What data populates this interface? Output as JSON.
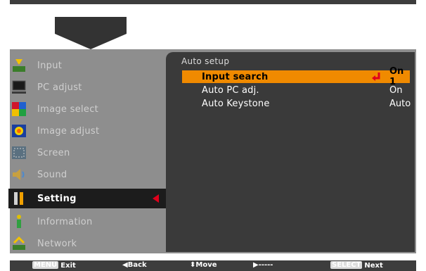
{
  "menu": {
    "items": [
      {
        "label": "Input",
        "icon": "input-icon"
      },
      {
        "label": "PC adjust",
        "icon": "pc-adjust-icon"
      },
      {
        "label": "Image select",
        "icon": "image-select-icon"
      },
      {
        "label": "Image adjust",
        "icon": "image-adjust-icon"
      },
      {
        "label": "Screen",
        "icon": "screen-icon"
      },
      {
        "label": "Sound",
        "icon": "sound-icon"
      },
      {
        "label": "Setting",
        "icon": "setting-icon"
      },
      {
        "label": "Information",
        "icon": "information-icon"
      },
      {
        "label": "Network",
        "icon": "network-icon"
      }
    ],
    "active": "Setting"
  },
  "panel": {
    "title": "Auto setup",
    "rows": [
      {
        "name": "Input search",
        "value": "On 1"
      },
      {
        "name": "Auto PC adj.",
        "value": "On"
      },
      {
        "name": "Auto Keystone",
        "value": "Auto"
      }
    ],
    "selected": "Input search"
  },
  "help": {
    "exit_key": "MENU",
    "exit": "Exit",
    "back": "Back",
    "move": "Move",
    "next_field": "-----",
    "next_key": "SELECT",
    "next": "Next"
  },
  "colors": {
    "highlight": "#f08a00",
    "panel": "#3a3a3a",
    "frame": "#8e8e8e",
    "active_marker": "#e0001b"
  }
}
